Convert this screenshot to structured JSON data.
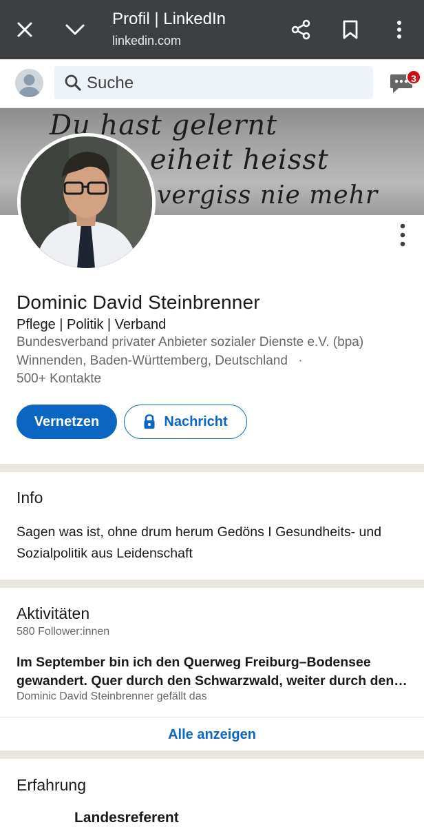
{
  "browser": {
    "title": "Profil | LinkedIn",
    "url": "linkedin.com",
    "icons": [
      "close-icon",
      "chevron-down-icon",
      "share-icon",
      "bookmark-icon",
      "more-vert-icon"
    ]
  },
  "header": {
    "search_placeholder": "Suche",
    "messages_badge": "3"
  },
  "banner": {
    "line1": "Du hast gelernt",
    "line2": "eiheit heisst",
    "line3": "vergiss nie mehr"
  },
  "profile": {
    "name": "Dominic David Steinbrenner",
    "headline": "Pflege | Politik | Verband",
    "company": "Bundesverband privater Anbieter sozialer Dienste e.V. (bpa)",
    "location": "Winnenden, Baden-Württemberg, Deutschland",
    "location_separator": "·",
    "contacts": "500+ Kontakte",
    "connect_label": "Vernetzen",
    "message_label": "Nachricht"
  },
  "info": {
    "title": "Info",
    "text": "Sagen was ist, ohne drum herum Gedöns I Gesundheits- und Sozialpolitik aus Leidenschaft"
  },
  "activity": {
    "title": "Aktivitäten",
    "followers": "580 Follower:innen",
    "post_line1": "Im September bin ich den Querweg Freiburg–Bodensee",
    "post_line2": "gewandert. Quer durch den Schwarzwald, weiter durch den…",
    "post_meta": "Dominic David Steinbrenner gefällt das",
    "show_all": "Alle anzeigen"
  },
  "experience": {
    "title": "Erfahrung",
    "first_role": "Landesreferent"
  },
  "colors": {
    "brand_blue": "#0a66c2",
    "browser_bar": "#3c4043",
    "badge_red": "#cc1016",
    "divider": "#e9e5df"
  }
}
